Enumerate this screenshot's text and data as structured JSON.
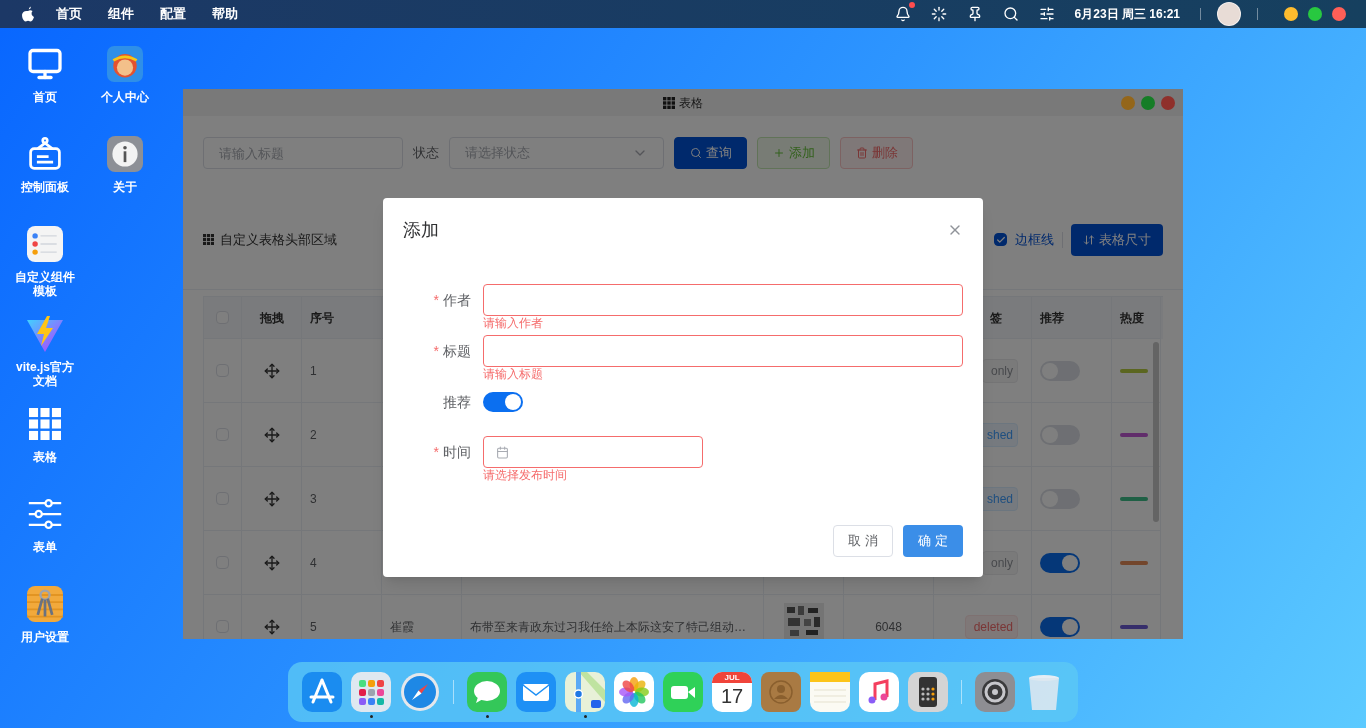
{
  "menu_bar": {
    "items": [
      "首页",
      "组件",
      "配置",
      "帮助"
    ],
    "notification_badge": true,
    "datetime": "6月23日 周三 16:21",
    "window_controls": [
      {
        "color": "#febc2e"
      },
      {
        "color": "#28c840"
      },
      {
        "color": "#ff5f57"
      }
    ]
  },
  "desktop": {
    "columns": [
      [
        {
          "kind": "monitor",
          "label": "首页"
        },
        {
          "kind": "signboard",
          "label": "控制面板"
        },
        {
          "kind": "reminders",
          "label": "自定义组件模板"
        },
        {
          "kind": "vite",
          "label": "vite.js官方文档"
        },
        {
          "kind": "grid",
          "label": "表格"
        },
        {
          "kind": "sliders",
          "label": "表单"
        },
        {
          "kind": "keys",
          "label": "用户设置"
        }
      ],
      [
        {
          "kind": "avatar",
          "label": "个人中心"
        },
        {
          "kind": "info",
          "label": "关于"
        }
      ]
    ]
  },
  "window": {
    "title": "表格",
    "controls": [
      {
        "color": "#94661a"
      },
      {
        "color": "#157d26"
      },
      {
        "color": "#8f302b"
      }
    ],
    "toolbar": {
      "title_placeholder": "请输入标题",
      "status_label": "状态",
      "status_placeholder": "请选择状态",
      "buttons": [
        {
          "kind": "query",
          "label": "查询"
        },
        {
          "kind": "add",
          "label": "添加"
        },
        {
          "kind": "delete",
          "label": "删除"
        }
      ]
    },
    "table_header": {
      "title": "自定义表格头部区域",
      "border_checked": true,
      "border_label": "边框线",
      "size_button": "表格尺寸"
    },
    "table": {
      "select_all_checked": false,
      "columns": [
        "拖拽",
        "序号",
        "签",
        "推荐",
        "热度"
      ],
      "rows": [
        {
          "checked": false,
          "index": "1",
          "tag": {
            "kind": "info",
            "label": "only"
          },
          "recommended": false,
          "heat_bar": {
            "color": "#5b6620"
          }
        },
        {
          "checked": false,
          "index": "2",
          "tag": {
            "kind": "primary",
            "label": "shed"
          },
          "recommended": false,
          "heat_bar": {
            "color": "#612d6b"
          }
        },
        {
          "checked": false,
          "index": "3",
          "tag": {
            "kind": "primary",
            "label": "shed"
          },
          "recommended": false,
          "heat_bar": {
            "color": "#1f6045"
          }
        },
        {
          "checked": false,
          "index": "4",
          "tag": {
            "kind": "info",
            "label": "only"
          },
          "recommended": true,
          "heat_bar": {
            "color": "#73462c"
          }
        },
        {
          "checked": false,
          "index": "5",
          "name": "崔霞",
          "title": "布带至来青政东过习我任给上本际这安了特己组动…",
          "count": "6048",
          "tag": {
            "kind": "danger",
            "label": "deleted"
          },
          "recommended": true,
          "heat_bar": {
            "color": "#362e6b"
          }
        }
      ]
    }
  },
  "dialog": {
    "title": "添加",
    "fields": [
      {
        "kind": "text",
        "label": "作者",
        "required_mark": "*",
        "error": "请输入作者"
      },
      {
        "kind": "text",
        "label": "标题",
        "required_mark": "*",
        "error": "请输入标题"
      },
      {
        "kind": "switch",
        "label": "推荐",
        "on": true
      },
      {
        "kind": "date",
        "label": "时间",
        "required_mark": "*",
        "error": "请选择发布时间"
      }
    ],
    "cancel": "取 消",
    "confirm": "确 定"
  },
  "dock": {
    "items": [
      {
        "kind": "appstore",
        "running": false
      },
      {
        "kind": "launchpad",
        "running": true
      },
      {
        "kind": "safari",
        "running": false
      },
      {
        "kind": "divider"
      },
      {
        "kind": "messages",
        "running": true
      },
      {
        "kind": "mail",
        "running": false
      },
      {
        "kind": "maps",
        "running": true
      },
      {
        "kind": "photos",
        "running": false
      },
      {
        "kind": "facetime",
        "running": false
      },
      {
        "kind": "calendar",
        "running": false,
        "month": "JUL",
        "day": "17"
      },
      {
        "kind": "contacts",
        "running": false
      },
      {
        "kind": "notes",
        "running": false
      },
      {
        "kind": "music",
        "running": false
      },
      {
        "kind": "calculator",
        "running": false
      },
      {
        "kind": "divider"
      },
      {
        "kind": "settings",
        "running": false
      },
      {
        "kind": "trash",
        "running": false
      }
    ]
  }
}
